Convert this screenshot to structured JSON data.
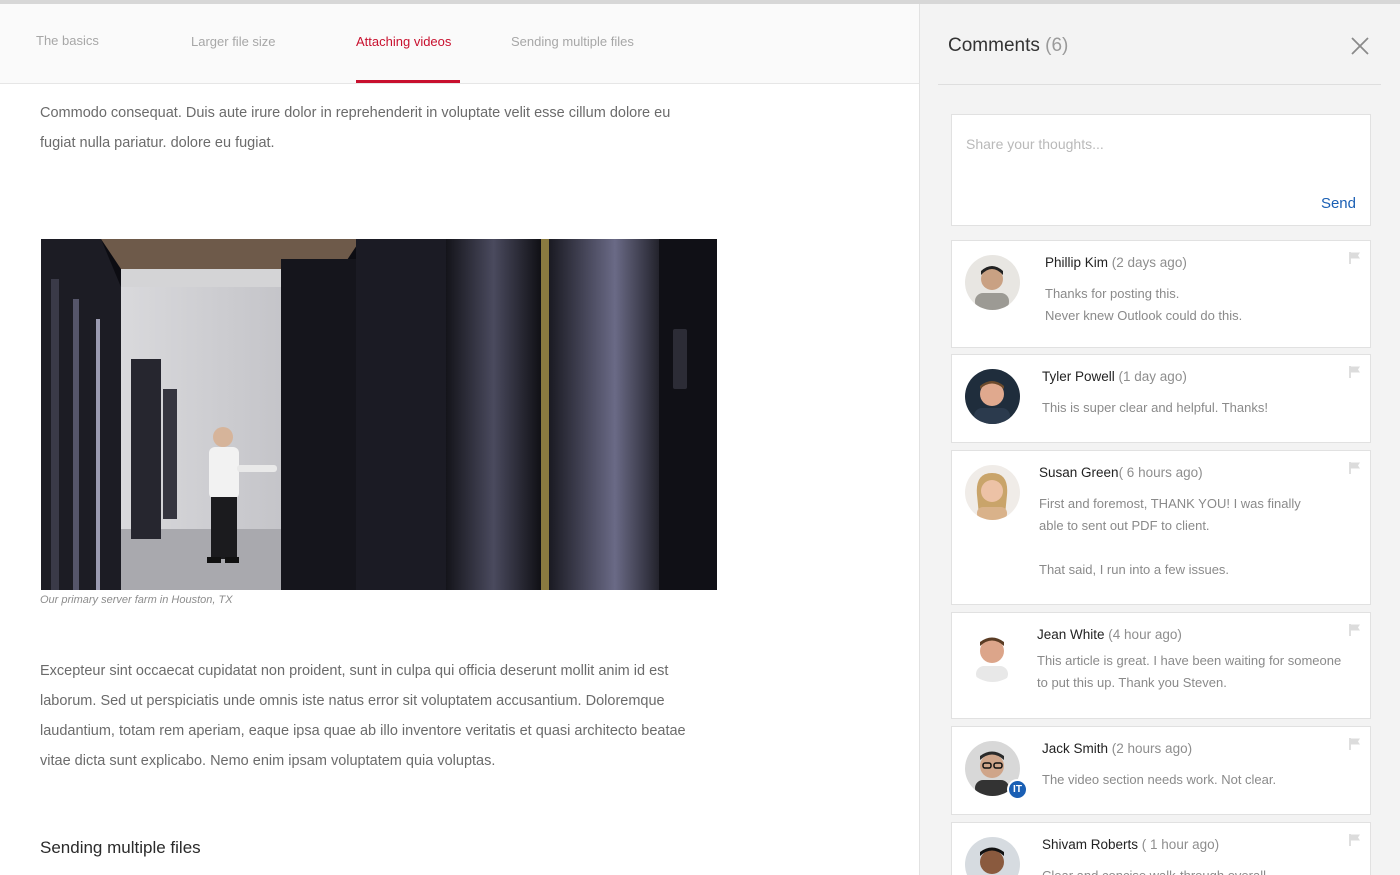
{
  "tabs": [
    {
      "label": "The basics"
    },
    {
      "label": "Larger file size"
    },
    {
      "label": "Attaching videos"
    },
    {
      "label": "Sending multiple files"
    }
  ],
  "article": {
    "intro_line1": "Commodo consequat. Duis aute irure dolor in reprehenderit in voluptate velit esse cillum dolore eu",
    "intro_line2": "fugiat nulla pariatur. dolore eu fugiat.",
    "caption": "Our primary server farm in Houston, TX",
    "body": "Excepteur sint occaecat cupidatat non proident, sunt in culpa qui officia deserunt mollit anim id est laborum. Sed ut perspiciatis unde omnis iste natus error sit voluptatem accusantium. Doloremque laudantium, totam rem aperiam, eaque ipsa quae ab illo inventore veritatis et quasi architecto beatae vitae dicta sunt explicabo. Nemo enim ipsam voluptatem quia voluptas.",
    "section_heading": "Sending multiple files"
  },
  "comments": {
    "title": "Comments",
    "count": "(6)",
    "placeholder": "Share your thoughts...",
    "send_label": "Send",
    "items": [
      {
        "name": "Phillip Kim",
        "time": " (2 days ago)",
        "lines": [
          "Thanks for posting this.",
          "Never knew Outlook could do this."
        ]
      },
      {
        "name": "Tyler Powell",
        "time": " (1 day ago)",
        "lines": [
          "This is super clear and helpful. Thanks!"
        ]
      },
      {
        "name": "Susan Green",
        "time": "( 6 hours ago)",
        "lines": [
          "First and foremost, THANK YOU! I was finally",
          "able to sent out PDF to client.",
          "That said, I run into a few issues."
        ]
      },
      {
        "name": "Jean White",
        "time": " (4 hour ago)",
        "lines": [
          "This article is great. I have been waiting for someone",
          "to put this up. Thank you Steven."
        ]
      },
      {
        "name": "Jack Smith",
        "time": " (2 hours ago)",
        "badge": "IT",
        "lines": [
          "The video section needs work. Not clear."
        ]
      },
      {
        "name": "Shivam Roberts",
        "time": " ( 1 hour ago)",
        "lines": [
          "Clear and concise walk-through overall."
        ]
      }
    ]
  },
  "colors": {
    "accent_red": "#c8102e",
    "link_blue": "#1a5fb4"
  },
  "icons": {
    "close": "close-icon",
    "flag": "flag-icon"
  }
}
